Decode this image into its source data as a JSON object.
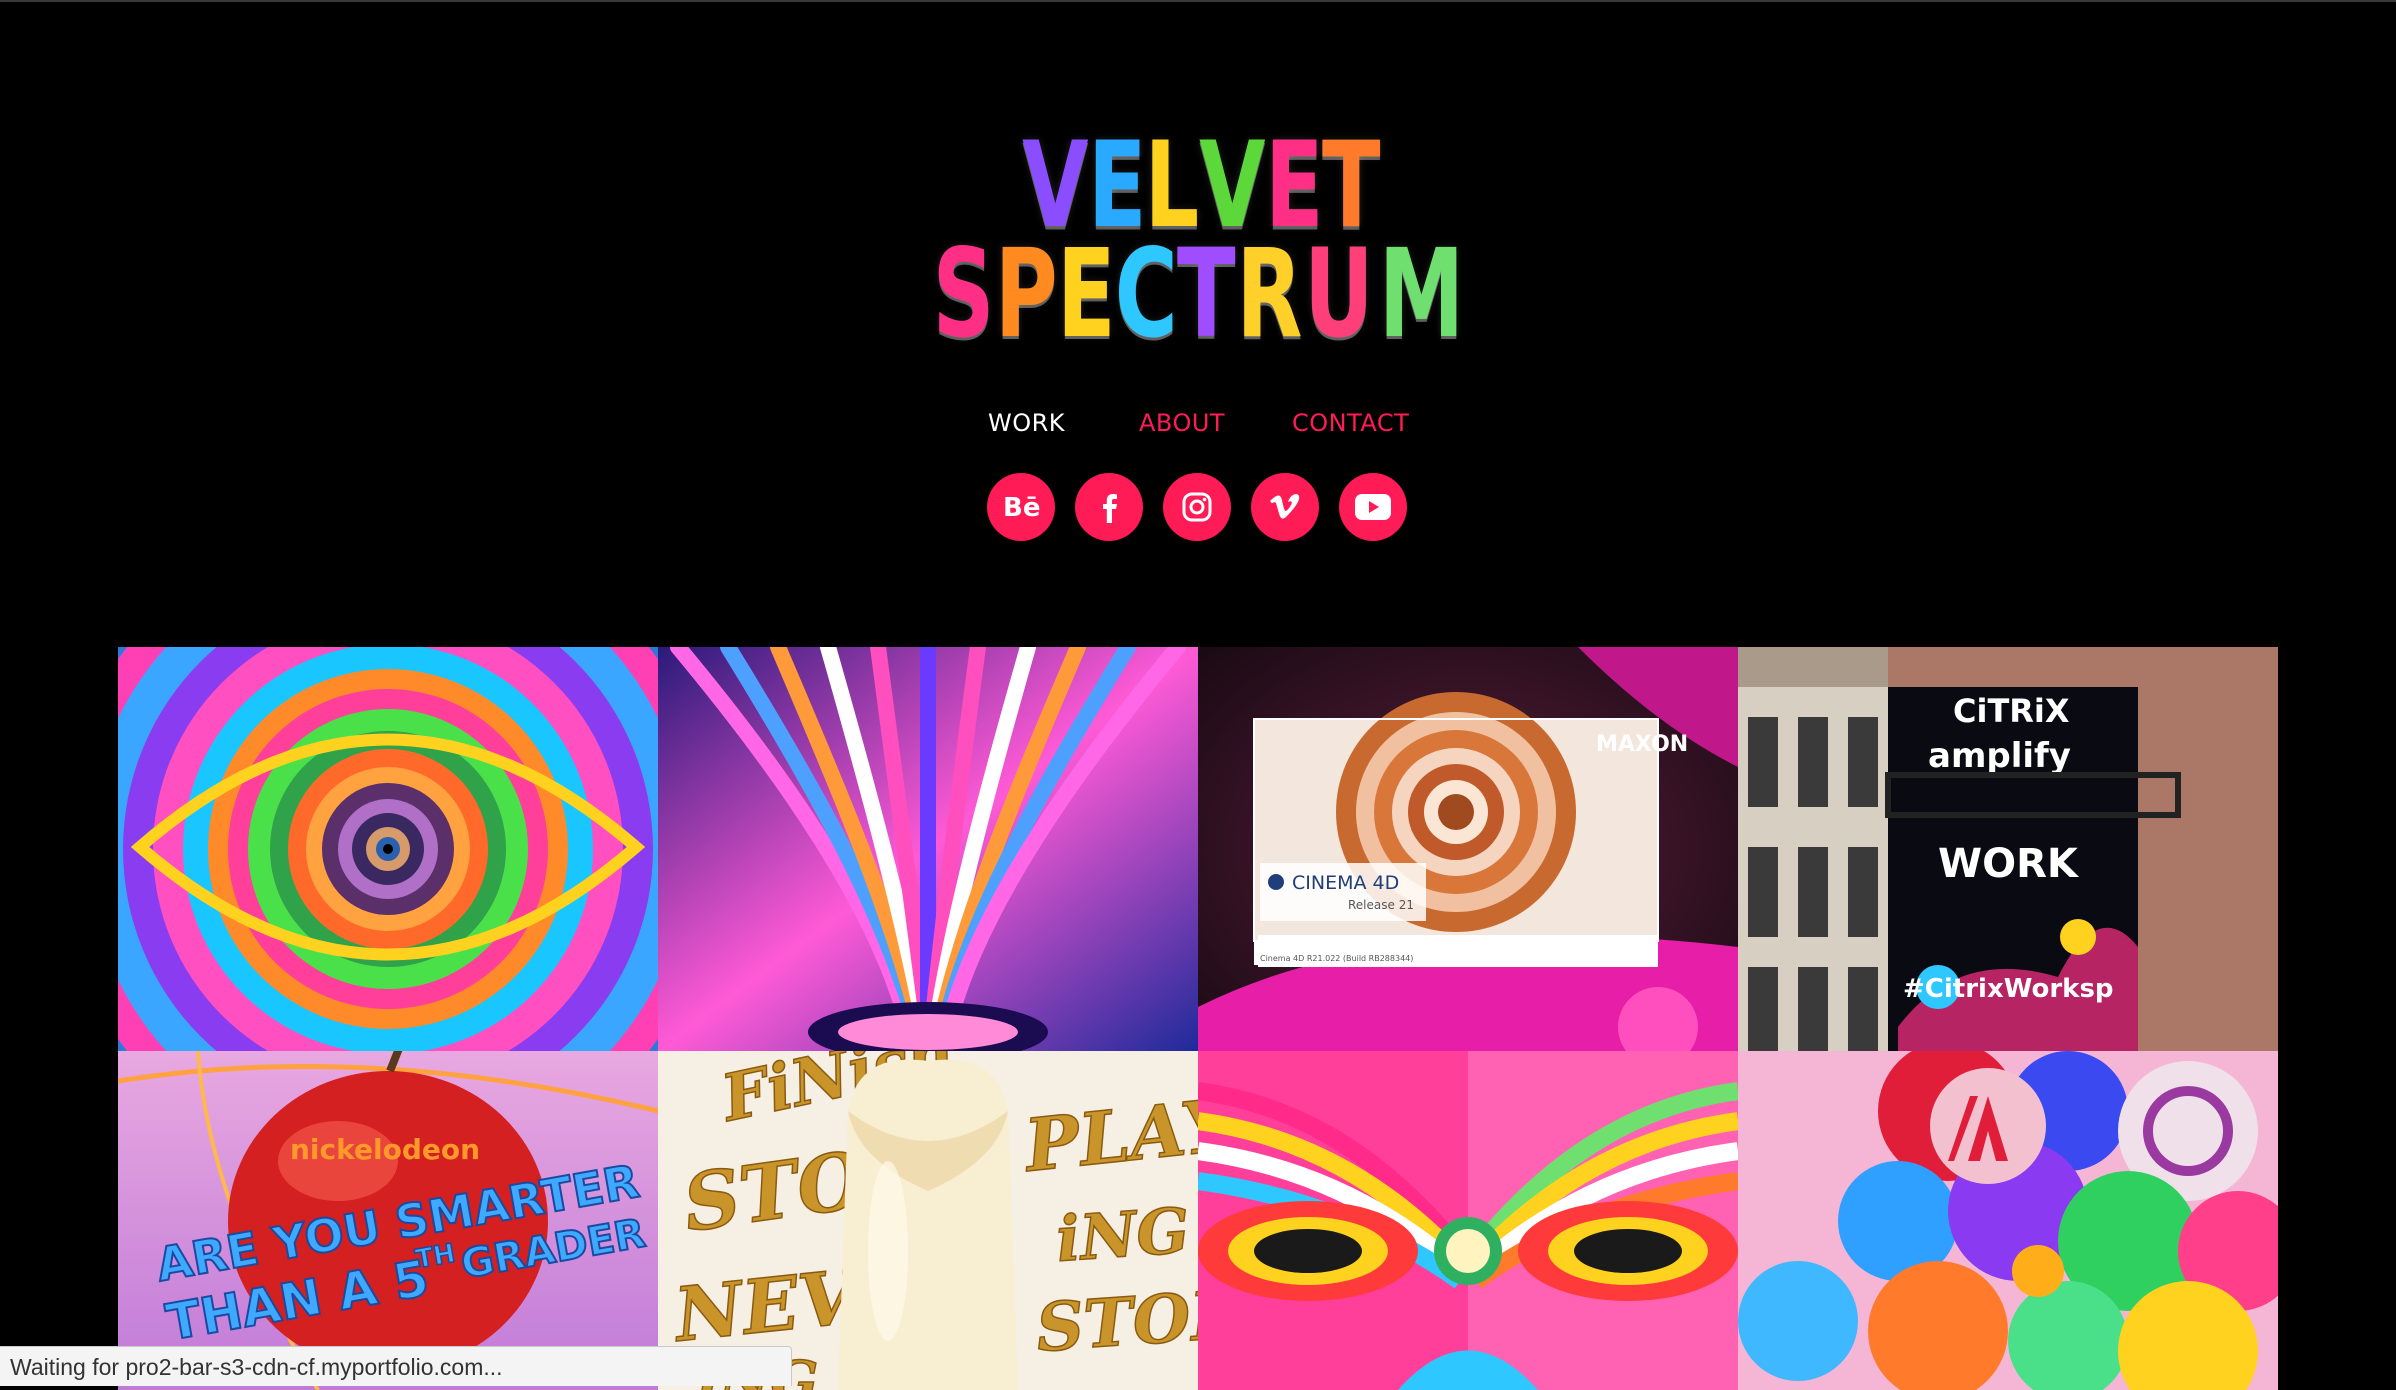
{
  "site": {
    "logo_line1": "VELVET",
    "logo_line2": "SPECTRUM",
    "logo_colors": {
      "V": "#8a4dff",
      "E": "#29a9ff",
      "L": "#ffd21f",
      "V2": "#5dd83b",
      "E2": "#ff2f86",
      "T": "#ff7a2a",
      "S": "#ff2f86",
      "P": "#ff8a1f",
      "E3": "#ffd21f",
      "C": "#2fc7ff",
      "T2": "#a04dff",
      "R": "#ffcf2a",
      "U": "#ff3f7a",
      "M": "#6fe070"
    }
  },
  "nav": {
    "work": "WORK",
    "about": "ABOUT",
    "contact": "CONTACT"
  },
  "social": [
    {
      "name": "behance",
      "label": "Bē",
      "icon": "behance-icon"
    },
    {
      "name": "facebook",
      "label": "f",
      "icon": "facebook-icon"
    },
    {
      "name": "instagram",
      "label": "",
      "icon": "instagram-icon"
    },
    {
      "name": "vimeo",
      "label": "v",
      "icon": "vimeo-icon"
    },
    {
      "name": "youtube",
      "label": "",
      "icon": "youtube-icon"
    }
  ],
  "projects": {
    "maxon_logo": "MAXON",
    "cinema4d_title": "CINEMA 4D",
    "cinema4d_release": "Release 21",
    "cinema4d_build": "Cinema 4D R21.022 (Build RB288344)",
    "citrix_logo": "CiTRiX",
    "citrix_word1": "amplify",
    "citrix_word2": "WORK",
    "citrix_hashtag": "#CitrixWorksp",
    "nick_brand": "nickelodeon",
    "nick_line1": "ARE YOU SMARTER",
    "nick_line2": "THAN A 5",
    "nick_th": "TH",
    "nick_grader": "GRADER",
    "type_words": [
      "FiNish",
      "STOP",
      "PLAY",
      "NEVER",
      "iNG",
      "STOP",
      "iNG"
    ]
  },
  "browser_status": "Waiting for pro2-bar-s3-cdn-cf.myportfolio.com...",
  "colors": {
    "accent": "#ff1b55",
    "background": "#000000",
    "nav_active": "#ffffff"
  }
}
